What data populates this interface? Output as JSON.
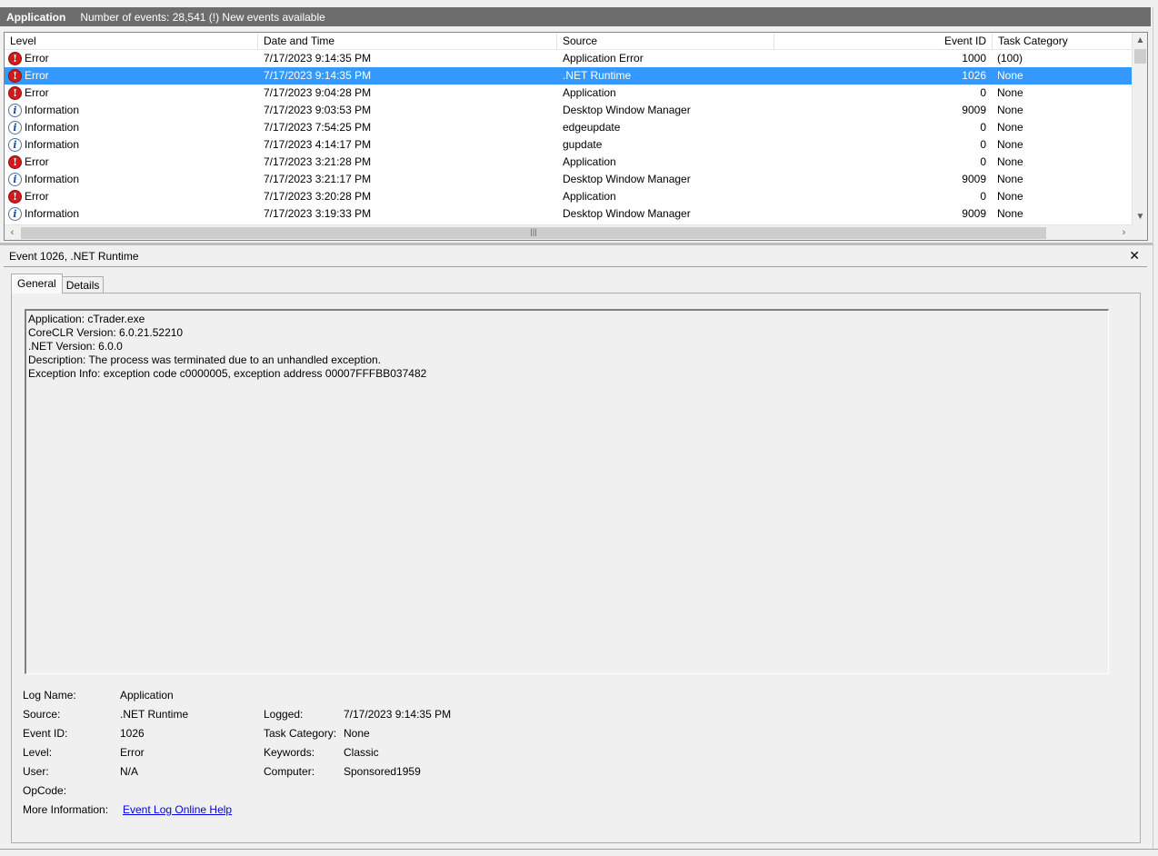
{
  "header": {
    "log_name": "Application",
    "summary": "Number of events: 28,541 (!) New events available"
  },
  "columns": {
    "level": "Level",
    "date": "Date and Time",
    "source": "Source",
    "event_id": "Event ID",
    "task": "Task Category"
  },
  "events": [
    {
      "level": "Error",
      "icon": "error-icon",
      "date": "7/17/2023 9:14:35 PM",
      "source": "Application Error",
      "event_id": "1000",
      "task": "(100)"
    },
    {
      "level": "Error",
      "icon": "error-icon",
      "date": "7/17/2023 9:14:35 PM",
      "source": ".NET Runtime",
      "event_id": "1026",
      "task": "None"
    },
    {
      "level": "Error",
      "icon": "error-icon",
      "date": "7/17/2023 9:04:28 PM",
      "source": "Application",
      "event_id": "0",
      "task": "None"
    },
    {
      "level": "Information",
      "icon": "info-icon",
      "date": "7/17/2023 9:03:53 PM",
      "source": "Desktop Window Manager",
      "event_id": "9009",
      "task": "None"
    },
    {
      "level": "Information",
      "icon": "info-icon",
      "date": "7/17/2023 7:54:25 PM",
      "source": "edgeupdate",
      "event_id": "0",
      "task": "None"
    },
    {
      "level": "Information",
      "icon": "info-icon",
      "date": "7/17/2023 4:14:17 PM",
      "source": "gupdate",
      "event_id": "0",
      "task": "None"
    },
    {
      "level": "Error",
      "icon": "error-icon",
      "date": "7/17/2023 3:21:28 PM",
      "source": "Application",
      "event_id": "0",
      "task": "None"
    },
    {
      "level": "Information",
      "icon": "info-icon",
      "date": "7/17/2023 3:21:17 PM",
      "source": "Desktop Window Manager",
      "event_id": "9009",
      "task": "None"
    },
    {
      "level": "Error",
      "icon": "error-icon",
      "date": "7/17/2023 3:20:28 PM",
      "source": "Application",
      "event_id": "0",
      "task": "None"
    },
    {
      "level": "Information",
      "icon": "info-icon",
      "date": "7/17/2023 3:19:33 PM",
      "source": "Desktop Window Manager",
      "event_id": "9009",
      "task": "None"
    }
  ],
  "detail": {
    "title": "Event 1026, .NET Runtime",
    "tabs": [
      "General",
      "Details"
    ],
    "description": [
      "Application: cTrader.exe",
      "CoreCLR Version: 6.0.21.52210",
      ".NET Version: 6.0.0",
      "Description: The process was terminated due to an unhandled exception.",
      "Exception Info: exception code c0000005, exception address 00007FFFBB037482"
    ],
    "fields": {
      "log_name_label": "Log Name:",
      "log_name": "Application",
      "source_label": "Source:",
      "source": ".NET Runtime",
      "logged_label": "Logged:",
      "logged": "7/17/2023 9:14:35 PM",
      "event_id_label": "Event ID:",
      "event_id": "1026",
      "task_label": "Task Category:",
      "task": "None",
      "level_label": "Level:",
      "level": "Error",
      "keywords_label": "Keywords:",
      "keywords": "Classic",
      "user_label": "User:",
      "user": "N/A",
      "computer_label": "Computer:",
      "computer": "Sponsored1959",
      "opcode_label": "OpCode:",
      "opcode": "",
      "more_info_label": "More Information:",
      "more_info_link": "Event Log Online Help"
    }
  },
  "colors": {
    "title_bar": "#6d6d6d",
    "selection": "#3399ff",
    "error_icon": "#d31a1a",
    "info_icon": "#1d4d9b",
    "link": "#0000ee"
  }
}
